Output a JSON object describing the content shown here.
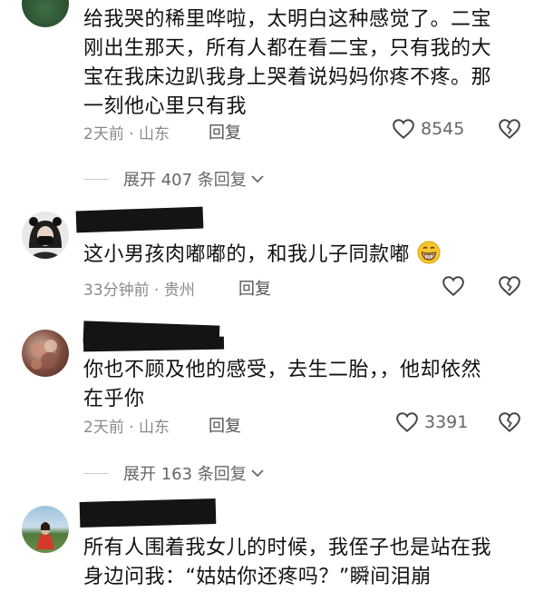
{
  "comments": [
    {
      "lines": [
        "给我哭的稀里哗啦，太明白这种感觉了。二宝",
        "刚出生那天，所有人都在看二宝，只有我的大",
        "宝在我床边趴我身上哭着说妈妈你疼不疼。那",
        "一刻他心里只有我"
      ],
      "time_location": "2天前 · 山东",
      "reply_label": "回复",
      "likes": "8545"
    },
    {
      "lines": [
        "这小男孩肉嘟嘟的，和我儿子同款嘟"
      ],
      "time_location": "33分钟前 · 贵州",
      "reply_label": "回复",
      "likes": ""
    },
    {
      "lines": [
        "你也不顾及他的感受，去生二胎，，他却依然",
        "在乎你"
      ],
      "time_location": "2天前 · 山东",
      "reply_label": "回复",
      "likes": "3391"
    },
    {
      "lines": [
        "所有人围着我女儿的时候，我侄子也是站在我",
        "身边问我：“姑姑你还疼吗？”瞬间泪崩"
      ]
    }
  ],
  "expand_links": [
    {
      "label": "展开 407 条回复"
    },
    {
      "label": "展开 163 条回复"
    }
  ],
  "colors": {
    "text": "#111111",
    "meta": "#8a8a8a",
    "redaction": "#141414"
  }
}
